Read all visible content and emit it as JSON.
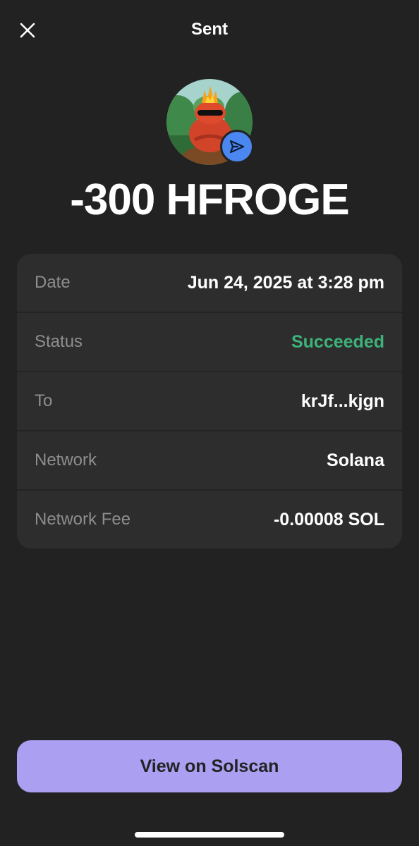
{
  "header": {
    "title": "Sent",
    "close_icon": "close-icon"
  },
  "token": {
    "avatar_icon": "frog-token-avatar",
    "badge_icon": "send-arrow-icon",
    "amount": "-300 HFROGE"
  },
  "details": [
    {
      "label": "Date",
      "value": "Jun 24, 2025 at 3:28 pm"
    },
    {
      "label": "Status",
      "value": "Succeeded"
    },
    {
      "label": "To",
      "value": "krJf...kjgn"
    },
    {
      "label": "Network",
      "value": "Solana"
    },
    {
      "label": "Network Fee",
      "value": "-0.00008 SOL"
    }
  ],
  "cta": {
    "label": "View on Solscan"
  },
  "colors": {
    "background": "#222222",
    "card": "#2d2d2d",
    "success": "#3eb27a",
    "accent": "#ab9ff2",
    "badge": "#4a87f0"
  }
}
